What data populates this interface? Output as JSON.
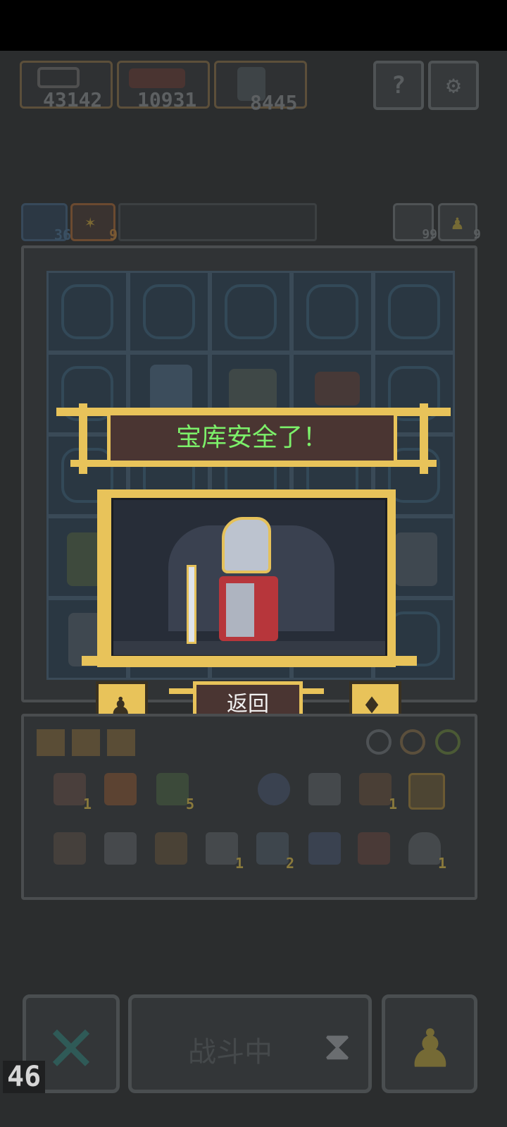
{
  "resources": [
    {
      "name": "chest-resource",
      "value": "43142"
    },
    {
      "name": "meat-resource",
      "value": "10931"
    },
    {
      "name": "hero-resource",
      "value": "8445"
    }
  ],
  "top_buttons": {
    "help_label": "?",
    "settings_label": "⚙"
  },
  "inventory_bar": {
    "left_counts": [
      "36",
      "9"
    ],
    "right_counts": [
      "99",
      "9"
    ]
  },
  "banner": {
    "title": "宝库安全了！"
  },
  "dialog": {
    "return_label": "返回"
  },
  "items_row1": [
    {
      "icon": "lantern-icon",
      "count": "1"
    },
    {
      "icon": "shield-icon",
      "count": ""
    },
    {
      "icon": "goblin-icon",
      "count": "5"
    },
    {
      "icon": "orb-icon",
      "count": ""
    },
    {
      "icon": "boot-icon",
      "count": ""
    },
    {
      "icon": "telescope-icon",
      "count": "1"
    },
    {
      "icon": "map-icon",
      "count": ""
    }
  ],
  "items_row2": [
    {
      "icon": "spike-trap-icon",
      "count": ""
    },
    {
      "icon": "crystal-icon",
      "count": ""
    },
    {
      "icon": "ship-icon",
      "count": ""
    },
    {
      "icon": "anvil-icon",
      "count": "1"
    },
    {
      "icon": "boot-icon-2",
      "count": "2"
    },
    {
      "icon": "cauldron-icon",
      "count": ""
    },
    {
      "icon": "book-icon",
      "count": ""
    },
    {
      "icon": "cloud-icon",
      "count": "1"
    }
  ],
  "bottom": {
    "fight_label": "战斗中",
    "fps": "46"
  },
  "colors": {
    "gold": "#e8c35a",
    "banner_text": "#7cf06a",
    "bg": "#2b2d2e"
  }
}
